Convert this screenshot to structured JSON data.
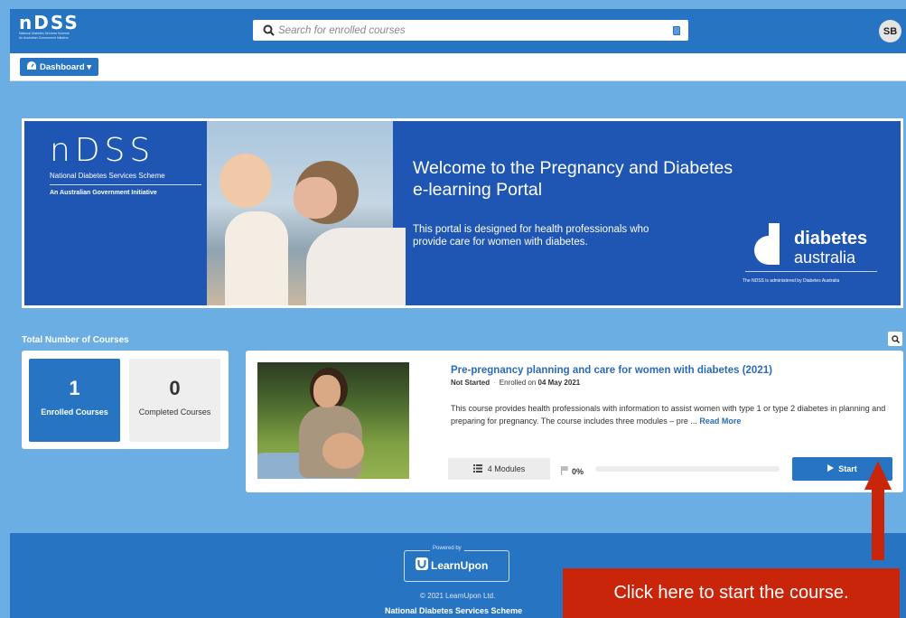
{
  "header": {
    "logo": {
      "word": "nDSS",
      "sub1": "National Diabetes Services Scheme",
      "sub2": "An Australian Government Initiative"
    },
    "search": {
      "placeholder": "Search for enrolled courses"
    },
    "avatar": "SB",
    "icons": {
      "search": "search-icon",
      "catalog": "book-icon"
    }
  },
  "subnav": {
    "dashboard_label": "Dashboard ▾"
  },
  "banner": {
    "logo_word": "nDSS",
    "scheme_name": "National Diabetes Services Scheme",
    "initiative": "An Australian Government Initiative",
    "title": "Welcome to the Pregnancy and Diabetes e-learning Portal",
    "description": "This portal is designed for health professionals who provide care for women with diabetes.",
    "partner_word1": "diabetes",
    "partner_word2": "australia",
    "partner_note": "The NDSS is administered by Diabetes Australia"
  },
  "stats": {
    "section_title": "Total Number of Courses",
    "enrolled": {
      "count": "1",
      "label": "Enrolled Courses"
    },
    "completed": {
      "count": "0",
      "label": "Completed Courses"
    }
  },
  "course": {
    "title": "Pre-pregnancy planning and care for women with diabetes (2021)",
    "status": "Not Started",
    "enrolled_prefix": "Enrolled on",
    "enrolled_date": "04 May 2021",
    "description": "This course provides health professionals with information to assist women with type 1 or type 2 diabetes in planning and preparing for pregnancy. The course includes three modules – pre ...",
    "read_more": "Read More",
    "modules_label": "4 Modules",
    "progress_text": "0%",
    "progress_value": 0,
    "start_label": "Start"
  },
  "footer": {
    "powered_by": "Powered by",
    "brand": "LearnUpon",
    "copyright": "© 2021 LearnUpon Ltd.",
    "org": "National Diabetes Services Scheme"
  },
  "annotation": {
    "callout": "Click here to start the course."
  },
  "colors": {
    "primary": "#2775c2",
    "page_bg": "#6aaee3",
    "banner": "#1f56b3",
    "callout": "#c9250a"
  }
}
